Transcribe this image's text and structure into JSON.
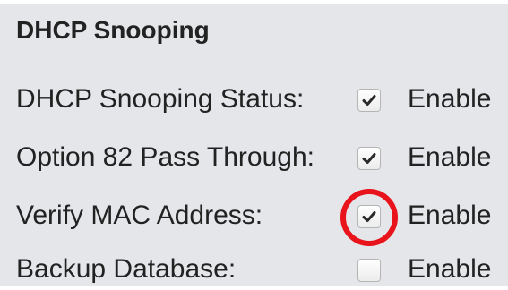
{
  "section": {
    "title": "DHCP Snooping"
  },
  "settings": [
    {
      "label": "DHCP Snooping Status:",
      "checked": true,
      "option_label": "Enable"
    },
    {
      "label": "Option 82 Pass Through:",
      "checked": true,
      "option_label": "Enable"
    },
    {
      "label": "Verify MAC Address:",
      "checked": true,
      "option_label": "Enable"
    },
    {
      "label": "Backup Database:",
      "checked": false,
      "option_label": "Enable"
    }
  ],
  "annotation": {
    "color": "#e8131b",
    "target": "settings.2"
  },
  "colors": {
    "panel_background": "#e4e6e9",
    "text": "#222222",
    "check_mark": "#2a2a2a"
  }
}
